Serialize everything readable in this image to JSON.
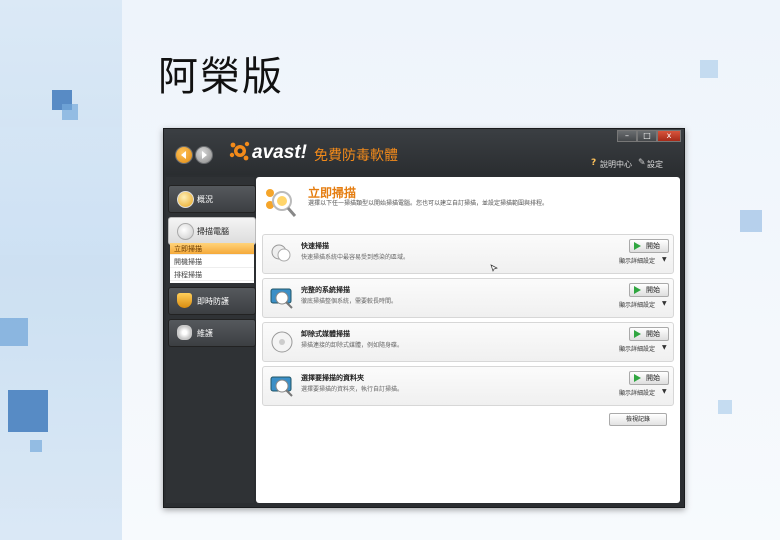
{
  "slide": {
    "title": "阿榮版"
  },
  "app": {
    "logo_text": "avast!",
    "product_name": "免費防毒軟體",
    "window_controls": {
      "minimize": "–",
      "maximize": "□",
      "close": "x"
    },
    "links": {
      "help": "說明中心",
      "settings": "設定"
    }
  },
  "sidebar": {
    "items": [
      {
        "label": "概況"
      },
      {
        "label": "掃描電腦"
      },
      {
        "label": "即時防護"
      },
      {
        "label": "維護"
      }
    ],
    "subitems": [
      {
        "label": "立即掃描"
      },
      {
        "label": "開機掃描"
      },
      {
        "label": "排程掃描"
      }
    ]
  },
  "content": {
    "header_title": "立即掃描",
    "header_desc": "選擇以下任一掃描類型以開始掃描電腦。您也可以建立自訂掃描，並設定掃描範圍與排程。",
    "scans": [
      {
        "title": "快速掃描",
        "desc": "快速掃描系統中最容易受到感染的區域。",
        "start": "開始",
        "options": "顯示詳細設定"
      },
      {
        "title": "完整的系統掃描",
        "desc": "徹底掃描整個系統，需要較長時間。",
        "start": "開始",
        "options": "顯示詳細設定"
      },
      {
        "title": "卸除式媒體掃描",
        "desc": "掃描連接的卸除式媒體，例如隨身碟。",
        "start": "開始",
        "options": "顯示詳細設定"
      },
      {
        "title": "選擇要掃描的資料夾",
        "desc": "選擇要掃描的資料夾，執行自訂掃描。",
        "start": "開始",
        "options": "顯示詳細設定"
      }
    ],
    "log_button": "檢視記錄"
  },
  "colors": {
    "accent": "#e57d10",
    "window_bg": "#2b2e31",
    "start_green": "#2fa640"
  }
}
